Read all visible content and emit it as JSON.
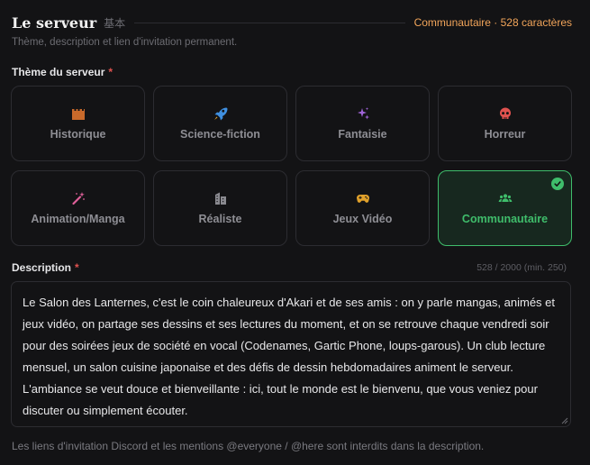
{
  "header": {
    "title": "Le serveur",
    "title_cjk": "基本",
    "summary": "Communautaire · 528 caractères",
    "subtitle": "Thème, description et lien d'invitation permanent."
  },
  "theme_field": {
    "label": "Thème du serveur",
    "required_mark": "*",
    "options": [
      {
        "label": "Historique",
        "icon": "castle-icon",
        "color": "#c96a2b"
      },
      {
        "label": "Science-fiction",
        "icon": "rocket-icon",
        "color": "#3f8fe0"
      },
      {
        "label": "Fantaisie",
        "icon": "sparkles-icon",
        "color": "#a064d8"
      },
      {
        "label": "Horreur",
        "icon": "skull-icon",
        "color": "#e0524f"
      },
      {
        "label": "Animation/Manga",
        "icon": "magic-wand-icon",
        "color": "#e0609a"
      },
      {
        "label": "Réaliste",
        "icon": "building-icon",
        "color": "#8a8a90"
      },
      {
        "label": "Jeux Vidéo",
        "icon": "gamepad-icon",
        "color": "#e0a12b"
      },
      {
        "label": "Communautaire",
        "icon": "users-icon",
        "color": "#3fbd6b"
      }
    ],
    "selected": "Communautaire"
  },
  "description_field": {
    "label": "Description",
    "required_mark": "*",
    "counter": "528 / 2000 (min. 250)",
    "value": "Le Salon des Lanternes, c'est le coin chaleureux d'Akari et de ses amis : on y parle mangas, animés et jeux vidéo, on partage ses dessins et ses lectures du moment, et on se retrouve chaque vendredi soir pour des soirées jeux de société en vocal (Codenames, Gartic Phone, loups-garous). Un club lecture mensuel, un salon cuisine japonaise et des défis de dessin hebdomadaires animent le serveur. L'ambiance se veut douce et bienveillante : ici, tout le monde est le bienvenu, que vous veniez pour discuter ou simplement écouter.",
    "hint": "Les liens d'invitation Discord et les mentions @everyone / @here sont interdits dans la description."
  },
  "colors": {
    "accent_orange": "#f2a55a",
    "accent_green": "#3fbd6b",
    "required_red": "#e0524f",
    "background": "#131315"
  }
}
